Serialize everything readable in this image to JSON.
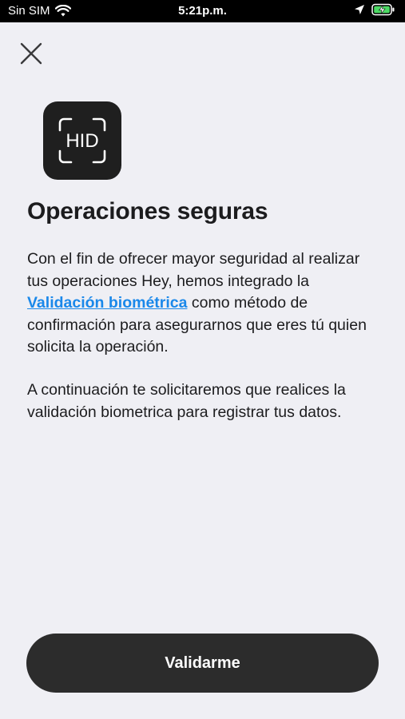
{
  "status_bar": {
    "carrier": "Sin SIM",
    "time": "5:21p.m.",
    "icons": [
      "wifi-icon",
      "location-arrow-icon",
      "battery-charging-icon"
    ]
  },
  "header": {
    "close_icon": "close-icon"
  },
  "app_icon": {
    "label": "HID"
  },
  "content": {
    "title": "Operaciones seguras",
    "paragraph1_before": "Con el fin de ofrecer mayor seguridad al realizar tus operaciones Hey, hemos integrado la ",
    "paragraph1_link": "Validación biométrica",
    "paragraph1_after": " como método de confirmación para asegurarnos que eres tú quien solicita la operación.",
    "paragraph2": "A continuación te solicitaremos que realices la validación biometrica para registrar tus datos."
  },
  "footer": {
    "cta_label": "Validarme"
  },
  "colors": {
    "background": "#efeff4",
    "link": "#1a88ea",
    "button": "#2c2c2c",
    "text": "#1c1c1e"
  }
}
